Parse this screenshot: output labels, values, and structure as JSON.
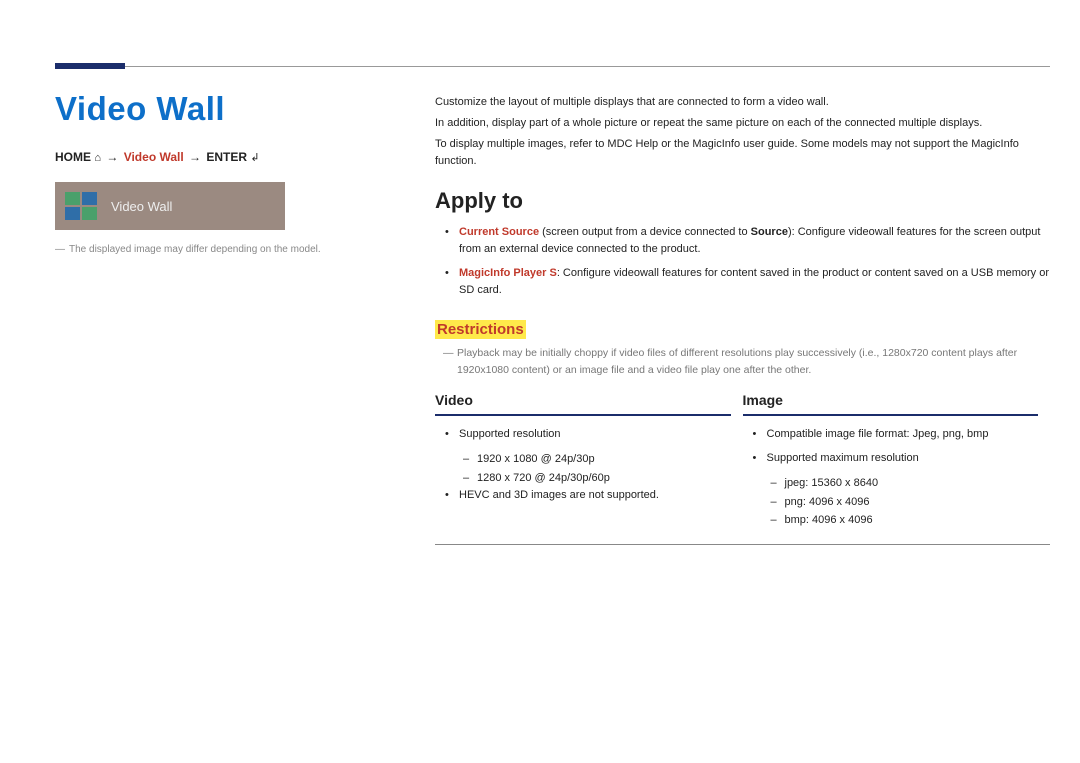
{
  "left": {
    "title": "Video Wall",
    "breadcrumb": {
      "home": "HOME",
      "mid": "Video Wall",
      "enter": "ENTER"
    },
    "tile_label": "Video Wall",
    "note": "The displayed image may differ depending on the model."
  },
  "intro": {
    "p1": "Customize the layout of multiple displays that are connected to form a video wall.",
    "p2": "In addition, display part of a whole picture or repeat the same picture on each of the connected multiple displays.",
    "p3": "To display multiple images, refer to MDC Help or the MagicInfo user guide. Some models may not support the MagicInfo function."
  },
  "apply": {
    "heading": "Apply to",
    "items": [
      {
        "lead": "Current Source",
        "mid1": " (screen output from a device connected to ",
        "src": "Source",
        "tail": "): Configure videowall features for the screen output from an external device connected to the product."
      },
      {
        "lead": "MagicInfo Player S",
        "tail": ": Configure videowall features for content saved in the product or content saved on a USB memory or SD card."
      }
    ]
  },
  "restrictions": {
    "heading": "Restrictions",
    "note": "Playback may be initially choppy if video files of different resolutions play successively (i.e., 1280x720 content plays after 1920x1080 content) or an image file and a video file play one after the other."
  },
  "split": {
    "video": {
      "heading": "Video",
      "b1": "Supported resolution",
      "d1": "1920 x 1080 @ 24p/30p",
      "d2": "1280 x 720 @ 24p/30p/60p",
      "b2": "HEVC and 3D images are not supported."
    },
    "image": {
      "heading": "Image",
      "b1": "Compatible image file format: Jpeg, png, bmp",
      "b2": "Supported maximum resolution",
      "d1": "jpeg: 15360 x 8640",
      "d2": "png: 4096 x 4096",
      "d3": "bmp: 4096 x 4096"
    }
  }
}
